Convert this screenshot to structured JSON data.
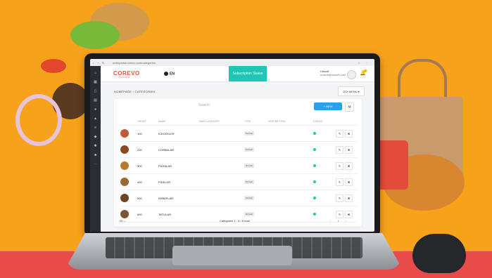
{
  "browser": {
    "url": "orderportal.corevo.com/categories"
  },
  "brand": {
    "name": "COREVO",
    "sub": "ORDER"
  },
  "header": {
    "language": "EN",
    "subscription_label": "Subscription Status",
    "user_name": "Unisoft",
    "user_email": "unisoft@unisoft.com"
  },
  "breadcrumb": "HOMEPAGE  ›  CATEGORIES",
  "go_menu_label": "GO! MENU  ▾",
  "search_placeholder": "Search",
  "new_button_label": "+ NEW",
  "table": {
    "columns": [
      "",
      "ORDER",
      "NAME",
      "MAIN CATEGORY",
      "TYPE",
      "DESCRIPTION",
      "STATUS",
      ""
    ],
    "rows": [
      {
        "order": "100",
        "name": "ICECEKLER",
        "type": "Normal"
      },
      {
        "order": "200",
        "name": "CORBALAR",
        "type": "Normal"
      },
      {
        "order": "300",
        "name": "PIZZALAR",
        "type": "Normal"
      },
      {
        "order": "400",
        "name": "PIDELER",
        "type": "Normal"
      },
      {
        "order": "500",
        "name": "KEBAPLAR",
        "type": "Normal"
      },
      {
        "order": "600",
        "name": "TATLILAR",
        "type": "Normal"
      }
    ]
  },
  "footer": {
    "page_size": "20",
    "info": "Categories 1 - 6 / 6 total",
    "pager": "‹ 1 ›"
  },
  "colors": {
    "accent": "#1fc6b5",
    "primary": "#2aa1e8",
    "background": "#f7a21b",
    "brand": "#e9503f"
  }
}
